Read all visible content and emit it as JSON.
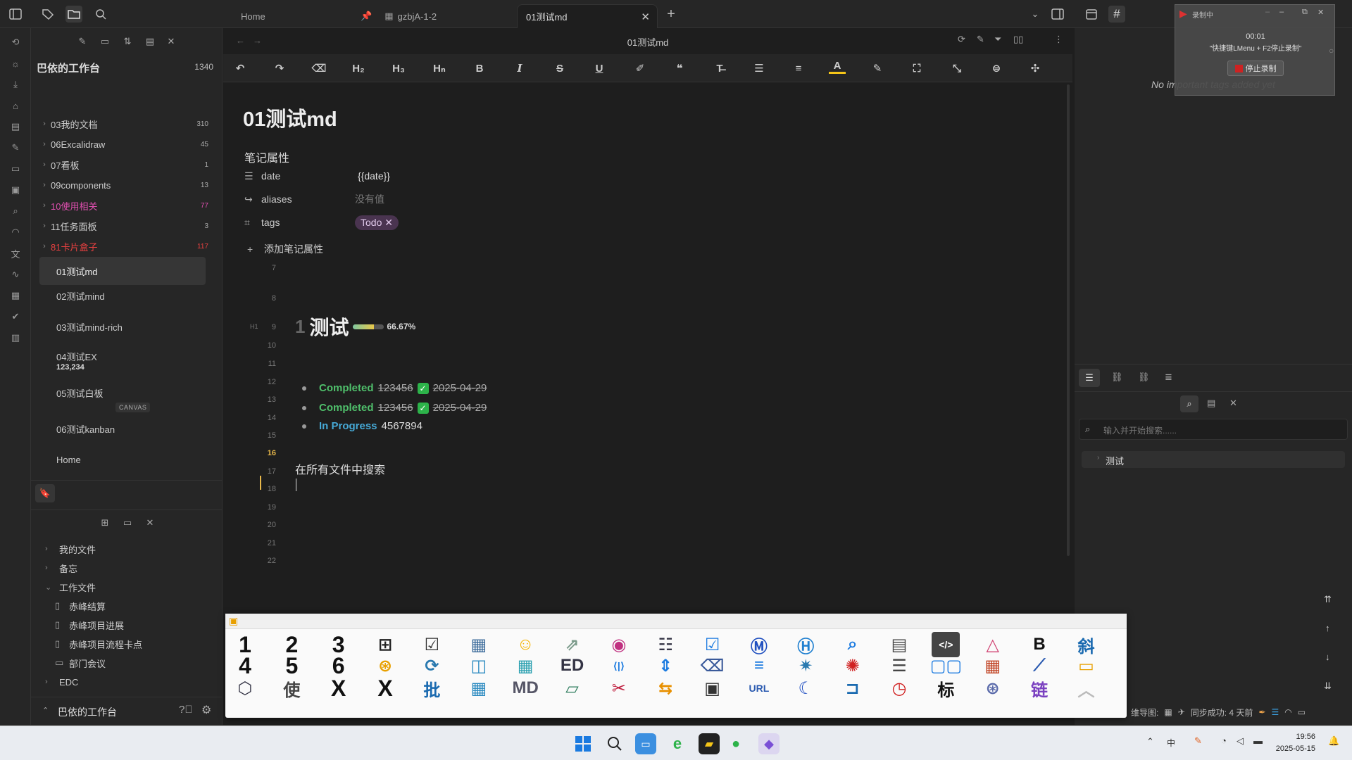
{
  "tabs": [
    {
      "label": "Home"
    },
    {
      "label": "gzbjA-1-2"
    },
    {
      "label": "01测试md"
    }
  ],
  "explorer": {
    "vault_name": "巴依的工作台",
    "vault_count": "1340",
    "folders": [
      {
        "label": "03我的文档",
        "count": "310",
        "color": "#cccccc"
      },
      {
        "label": "06Excalidraw",
        "count": "45",
        "color": "#cccccc"
      },
      {
        "label": "07看板",
        "count": "1",
        "color": "#cccccc"
      },
      {
        "label": "09components",
        "count": "13",
        "color": "#cccccc"
      },
      {
        "label": "10使用相关",
        "count": "77",
        "color": "#e04fb0"
      },
      {
        "label": "11任务面板",
        "count": "3",
        "color": "#cccccc"
      },
      {
        "label": "81卡片盒子",
        "count": "117",
        "color": "#e84040"
      }
    ],
    "files": [
      {
        "label": "01测试md"
      },
      {
        "label": "02测试mind"
      },
      {
        "label": "03测试mind-rich"
      },
      {
        "label": "04测试EX",
        "sub": "123,234"
      },
      {
        "label": "05测试白板",
        "badge": "CANVAS"
      },
      {
        "label": "06测试kanban"
      },
      {
        "label": "Home"
      }
    ]
  },
  "bookmarks": {
    "items": [
      {
        "label": "我的文件"
      },
      {
        "label": "备忘"
      },
      {
        "label": "工作文件"
      },
      {
        "label": "赤峰结算"
      },
      {
        "label": "赤峰项目进展"
      },
      {
        "label": "赤峰项目流程卡点"
      },
      {
        "label": "部门会议"
      },
      {
        "label": "EDC"
      }
    ],
    "footer_vault": "巴依的工作台"
  },
  "editor": {
    "header_title": "01测试md",
    "title": "01测试md",
    "props_header": "笔记属性",
    "props": [
      {
        "key": "date",
        "value": "{{date}}"
      },
      {
        "key": "aliases",
        "value": "没有值"
      },
      {
        "key": "tags",
        "value": "Todo"
      }
    ],
    "add_prop": "添加笔记属性",
    "line_numbers": [
      "7",
      "8",
      "9",
      "10",
      "11",
      "12",
      "13",
      "14",
      "15",
      "16",
      "17",
      "18",
      "19",
      "20",
      "21",
      "22"
    ],
    "h1_marker": "H1",
    "heading_num": "1",
    "heading_text": "测试",
    "progress_pct": 66.67,
    "progress_text": "66.67%",
    "items": [
      {
        "status": "Completed",
        "text": "123456",
        "date": "2025-04-29"
      },
      {
        "status": "Completed",
        "text": "123456",
        "date": "2025-04-29"
      },
      {
        "status": "In Progress",
        "text": "4567894"
      }
    ],
    "search_line": "在所有文件中搜索"
  },
  "right": {
    "no_tags": "No important tags added yet",
    "search_placeholder": "输入并开始搜索......",
    "result": "测试",
    "status_left": "维导图:",
    "status_sync": "同步成功: 4 天前"
  },
  "recorder": {
    "title": "录制中",
    "time": "00:01",
    "hint": "\"快捷键LMenu + F2停止录制\"",
    "stop": "停止录制"
  },
  "launcher": {
    "row_labels": [
      "1",
      "2",
      "3",
      "4",
      "5",
      "6",
      "X",
      "X",
      "批",
      "B",
      "斜",
      "标"
    ]
  },
  "taskbar": {
    "time": "19:56",
    "date": "2025-05-15",
    "ime": "中"
  }
}
